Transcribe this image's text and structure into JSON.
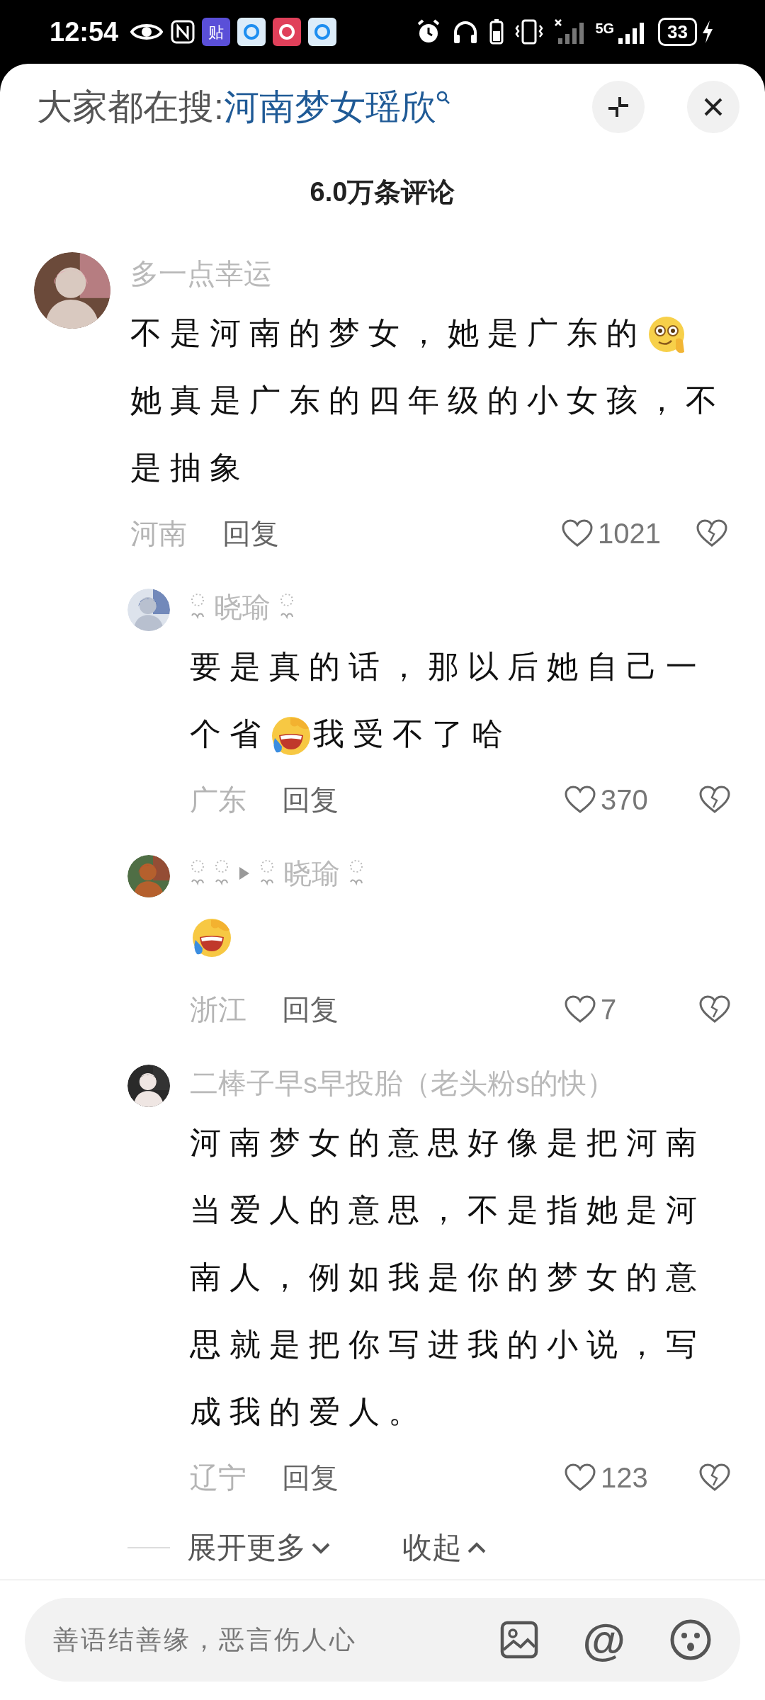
{
  "status_bar": {
    "time": "12:54",
    "apps": [
      {
        "label": "贴",
        "color": "#5a4fd8"
      },
      {
        "color": "#dcecf9"
      },
      {
        "color": "#e0405a"
      },
      {
        "color": "#dcecf9"
      }
    ],
    "network": "5G",
    "battery": "33"
  },
  "header": {
    "label": "大家都在搜:",
    "search_link": "河南梦女瑶欣"
  },
  "comment_count": "6.0万条评论",
  "comments": [
    {
      "author": "多一点幸运",
      "decorated": false,
      "reply": false,
      "body": [
        {
          "kind": "text",
          "text": "不是河南的梦女，她是广东的"
        },
        {
          "kind": "peek"
        },
        {
          "kind": "text",
          "text": "她真是广东的四年级的小女孩，不"
        },
        {
          "kind": "text",
          "text": "是抽象"
        }
      ],
      "region": "河南",
      "reply_label": "回复",
      "likes": "1021",
      "liked": false
    },
    {
      "author": "晓瑜",
      "decorated": true,
      "reply": true,
      "body": [
        {
          "kind": "text",
          "text": "要是真的话，那以后她自己一"
        },
        {
          "kind": "text",
          "text": "个省"
        },
        {
          "kind": "laugh"
        },
        {
          "kind": "text",
          "text": "我受不了哈"
        }
      ],
      "region": "广东",
      "reply_label": "回复",
      "likes": "370",
      "liked": false
    },
    {
      "reply_to": "晓瑜",
      "decorated": true,
      "reply": true,
      "body": [
        {
          "kind": "laugh"
        }
      ],
      "region": "浙江",
      "reply_label": "回复",
      "likes": "7",
      "liked": false
    },
    {
      "author": "二棒子早s早投胎（老头粉s的快）",
      "decorated": false,
      "reply": true,
      "body": [
        {
          "kind": "text",
          "text": "河南梦女的意思好像是把河南当爱人的意思，不是指她是河南人，例如我是你的梦女的意思就是把你写进我的小说，写成我的爱人。"
        }
      ],
      "region": "辽宁",
      "reply_label": "回复",
      "likes": "123",
      "liked": false
    }
  ],
  "expand_more": "展开更多",
  "collapse": "收起",
  "input": {
    "placeholder": "善语结善缘，恶言伤人心",
    "mention": "@"
  }
}
